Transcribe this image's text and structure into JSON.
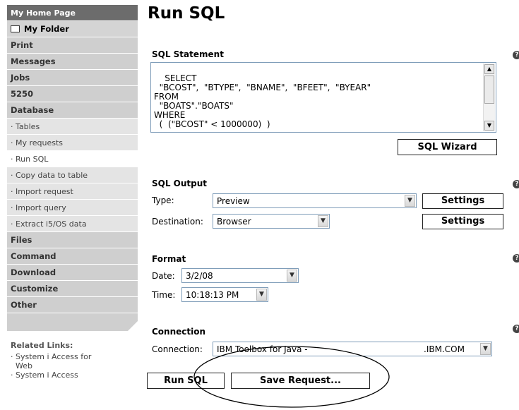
{
  "sidebar": {
    "home": "My Home Page",
    "folder": "My Folder",
    "items": [
      {
        "label": "Print",
        "kind": "cat"
      },
      {
        "label": "Messages",
        "kind": "cat"
      },
      {
        "label": "Jobs",
        "kind": "cat"
      },
      {
        "label": "5250",
        "kind": "cat"
      },
      {
        "label": "Database",
        "kind": "cat"
      },
      {
        "label": "· Tables",
        "kind": "sub"
      },
      {
        "label": "· My requests",
        "kind": "sub"
      },
      {
        "label": "· Run SQL",
        "kind": "sub",
        "active": true
      },
      {
        "label": "· Copy data to table",
        "kind": "sub"
      },
      {
        "label": "· Import request",
        "kind": "sub"
      },
      {
        "label": "· Import query",
        "kind": "sub"
      },
      {
        "label": "· Extract i5/OS data",
        "kind": "sub"
      },
      {
        "label": "Files",
        "kind": "cat"
      },
      {
        "label": "Command",
        "kind": "cat"
      },
      {
        "label": "Download",
        "kind": "cat"
      },
      {
        "label": "Customize",
        "kind": "cat"
      },
      {
        "label": "Other",
        "kind": "cat"
      }
    ],
    "related_title": "Related Links:",
    "related_links": [
      "· System i Access for",
      "  Web",
      "· System i Access"
    ]
  },
  "page": {
    "title": "Run SQL"
  },
  "sql_statement": {
    "title": "SQL Statement",
    "text": "SELECT\n  \"BCOST\",  \"BTYPE\",  \"BNAME\",  \"BFEET\",  \"BYEAR\"\nFROM\n  \"BOATS\".\"BOATS\"\nWHERE\n  (  (\"BCOST\" < 1000000)  )",
    "wizard_label": "SQL Wizard"
  },
  "sql_output": {
    "title": "SQL Output",
    "type_label": "Type:",
    "type_value": "Preview",
    "destination_label": "Destination:",
    "destination_value": "Browser",
    "settings_label": "Settings"
  },
  "format": {
    "title": "Format",
    "date_label": "Date:",
    "date_value": "3/2/08",
    "time_label": "Time:",
    "time_value": "10:18:13 PM"
  },
  "connection": {
    "title": "Connection",
    "label": "Connection:",
    "value_left": "IBM Toolbox for Java -",
    "value_right": ".IBM.COM"
  },
  "actions": {
    "run_label": "Run SQL",
    "save_label": "Save Request..."
  },
  "icons": {
    "help": "help-icon",
    "dropdown": "chevron-down-icon",
    "folder": "folder-icon"
  }
}
